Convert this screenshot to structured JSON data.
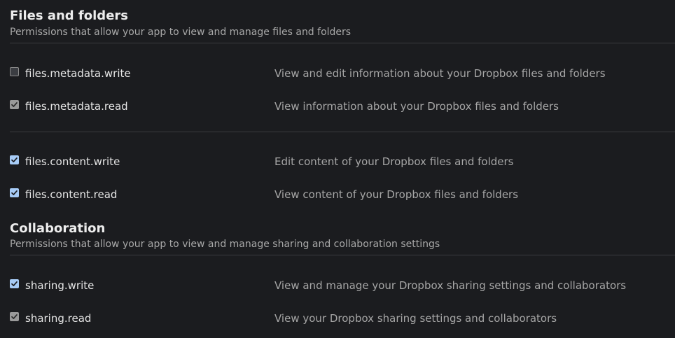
{
  "sections": [
    {
      "title": "Files and folders",
      "subtitle": "Permissions that allow your app to view and manage files and folders",
      "permissions": [
        {
          "scope": "files.metadata.write",
          "description": "View and edit information about your Dropbox files and folders",
          "state": "unchecked"
        },
        {
          "scope": "files.metadata.read",
          "description": "View information about your Dropbox files and folders",
          "state": "checked-disabled"
        },
        {
          "scope": "files.content.write",
          "description": "Edit content of your Dropbox files and folders",
          "state": "checked"
        },
        {
          "scope": "files.content.read",
          "description": "View content of your Dropbox files and folders",
          "state": "checked"
        }
      ]
    },
    {
      "title": "Collaboration",
      "subtitle": "Permissions that allow your app to view and manage sharing and collaboration settings",
      "permissions": [
        {
          "scope": "sharing.write",
          "description": "View and manage your Dropbox sharing settings and collaborators",
          "state": "checked"
        },
        {
          "scope": "sharing.read",
          "description": "View your Dropbox sharing settings and collaborators",
          "state": "checked-disabled"
        }
      ]
    }
  ],
  "colors": {
    "background": "#1b1c1f",
    "checkbox_checked": "#a7ccf7",
    "checkbox_disabled": "#9a9a9a"
  }
}
